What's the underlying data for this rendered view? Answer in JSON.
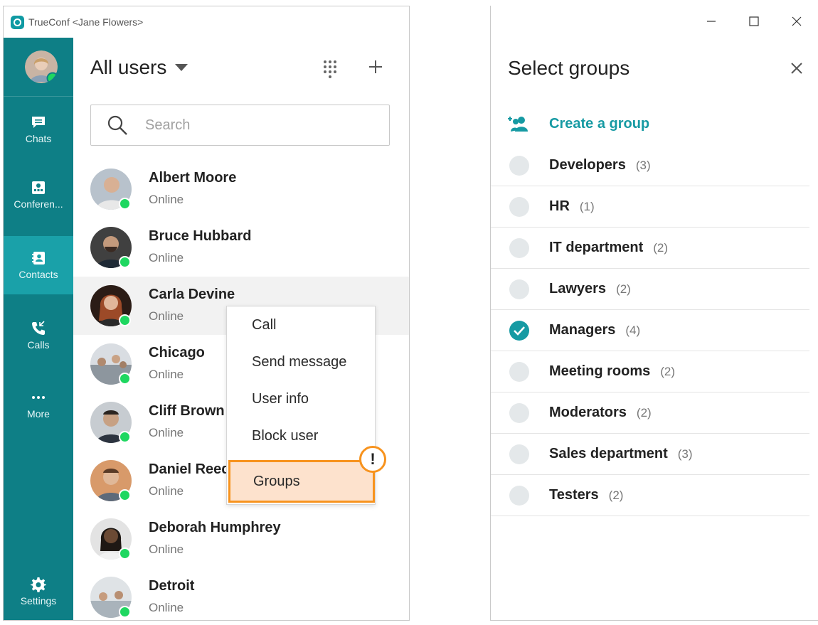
{
  "left_window": {
    "title": "TrueConf <Jane Flowers>",
    "nav": [
      {
        "label": "Chats",
        "icon": "chat-icon"
      },
      {
        "label": "Conferen...",
        "icon": "conference-icon"
      },
      {
        "label": "Contacts",
        "icon": "contacts-icon",
        "active": true
      },
      {
        "label": "Calls",
        "icon": "calls-icon"
      },
      {
        "label": "More",
        "icon": "more-icon"
      },
      {
        "label": "Settings",
        "icon": "gear-icon"
      }
    ],
    "header": {
      "title": "All users"
    },
    "search": {
      "placeholder": "Search"
    },
    "contacts": [
      {
        "name": "Albert Moore",
        "status": "Online"
      },
      {
        "name": "Bruce Hubbard",
        "status": "Online"
      },
      {
        "name": "Carla Devine",
        "status": "Online"
      },
      {
        "name": "Chicago",
        "status": "Online"
      },
      {
        "name": "Cliff Brown",
        "status": "Online"
      },
      {
        "name": "Daniel Reed",
        "status": "Online"
      },
      {
        "name": "Deborah Humphrey",
        "status": "Online"
      },
      {
        "name": "Detroit",
        "status": "Online"
      }
    ],
    "context_menu": [
      "Call",
      "Send message",
      "User info",
      "Block user",
      "Groups"
    ],
    "badge": "!"
  },
  "right_window": {
    "title": "Select groups",
    "create_group": "Create a group",
    "groups": [
      {
        "name": "Developers",
        "count": "(3)",
        "checked": false
      },
      {
        "name": "HR",
        "count": "(1)",
        "checked": false
      },
      {
        "name": "IT department",
        "count": "(2)",
        "checked": false
      },
      {
        "name": "Lawyers",
        "count": "(2)",
        "checked": false
      },
      {
        "name": "Managers",
        "count": "(4)",
        "checked": true
      },
      {
        "name": "Meeting rooms",
        "count": "(2)",
        "checked": false
      },
      {
        "name": "Moderators",
        "count": "(2)",
        "checked": false
      },
      {
        "name": "Sales department",
        "count": "(3)",
        "checked": false
      },
      {
        "name": "Testers",
        "count": "(2)",
        "checked": false
      }
    ]
  },
  "colors": {
    "sidebar": "#0e7f86",
    "sidebar_active": "#1aa1a9",
    "accent": "#169aa3",
    "online": "#1ed760",
    "highlight_border": "#f7931e",
    "highlight_fill": "#fde2cd"
  }
}
